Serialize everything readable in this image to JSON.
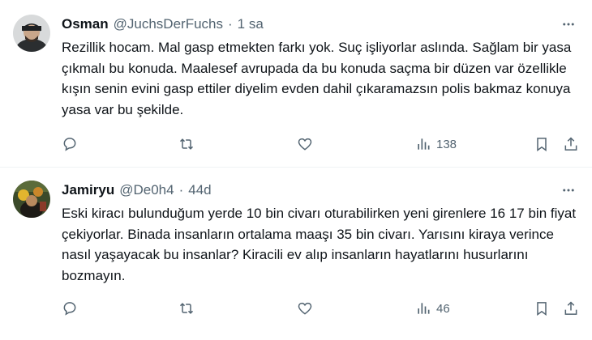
{
  "tweets": [
    {
      "name": "Osman",
      "handle": "@JuchsDerFuchs",
      "separator": "·",
      "time": "1 sa",
      "text": "Rezillik hocam. Mal gasp etmekten farkı yok. Suç işliyorlar aslında. Sağlam bir yasa çıkmalı bu konuda. Maalesef avrupada da bu konuda saçma bir düzen var özellikle kışın senin evini gasp ettiler diyelim evden dahil çıkaramazsın polis bakmaz konuya yasa var bu şekilde.",
      "views": "138",
      "icons": [
        "reply-icon",
        "retweet-icon",
        "like-icon",
        "views-icon",
        "bookmark-icon",
        "share-icon"
      ]
    },
    {
      "name": "Jamiryu",
      "handle": "@De0h4",
      "separator": "·",
      "time": "44d",
      "text": "Eski kiracı bulunduğum yerde 10 bin civarı oturabilirken yeni girenlere 16 17 bin fiyat çekiyorlar.  Binada insanların ortalama maaşı 35 bin civarı.  Yarısını kiraya verince nasıl yaşayacak bu insanlar? Kiracili ev alıp insanların hayatlarını husurlarını bozmayın.",
      "views": "46",
      "icons": [
        "reply-icon",
        "retweet-icon",
        "like-icon",
        "views-icon",
        "bookmark-icon",
        "share-icon"
      ]
    }
  ],
  "colors": {
    "text": "#0f1419",
    "muted": "#536471",
    "divider": "#eff3f4"
  }
}
